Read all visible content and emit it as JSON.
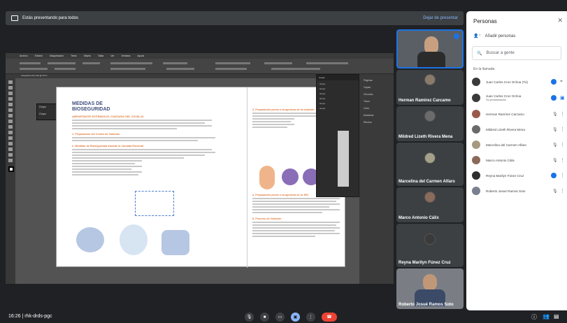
{
  "banner": {
    "presenting_text": "Estás presentando para todos",
    "stop_label": "Dejar de presentar"
  },
  "indesign": {
    "menu_items": [
      "Archivo",
      "Edición",
      "Maquetación",
      "Texto",
      "Objeto",
      "Tabla",
      "Ver",
      "Ventana",
      "Ayuda"
    ],
    "doc_tab": "Infografia-CSV.indd @ 39 %",
    "popup_label": "Grupo",
    "page": {
      "title_line1": "MEDIDAS DE",
      "title_line2": "BIOSEGURIDAD",
      "subtitle": "¡IMPORTANTE! EVITEMOS EL CONTAGIO DEL COVID-19",
      "section1": "1.  Preparación del Centro de Votación",
      "section2": "2.  Medidas de Bioseguridad durante la Jornada Electoral",
      "section3": "3.  Preparación previo a la apertura de la votación",
      "section4": "4.  Preparación previo a la apertura de la JRV",
      "section5": "5.  Proceso de Votación"
    },
    "layers_panel": {
      "title": "Capas",
      "items": [
        "Grupo",
        "Grupo",
        "Grupo",
        "Grupo",
        "Grupo",
        "Grupo"
      ]
    },
    "right_panel": [
      "Páginas",
      "Capas",
      "Vínculos",
      "Trazo",
      "Color",
      "Muestras",
      "Efectos"
    ]
  },
  "tiles": [
    {
      "name": "Herman Ramírez Carcamo"
    },
    {
      "name": "Mildred Lizeth Rivera Mena"
    },
    {
      "name": "Marcelina del Carmen Alfaro"
    },
    {
      "name": "Marco Antonio Cálix"
    },
    {
      "name": "Reyna Marilyn Fúnez Cruz"
    },
    {
      "name": "Roberto Josué Ramos Soto"
    }
  ],
  "people": {
    "title": "Personas",
    "add_label": "Añadir personas",
    "search_placeholder": "Buscar a gente",
    "section_label": "En la llamada",
    "members": [
      {
        "name": "Juan Carlos Cruz Ochoa (Tú)",
        "sub": ""
      },
      {
        "name": "Juan Carlos Cruz Ochoa",
        "sub": "Su presentación"
      },
      {
        "name": "Herman Ramírez Carcamo",
        "sub": ""
      },
      {
        "name": "Mildred Lizeth Rivera Mena",
        "sub": ""
      },
      {
        "name": "Marcelina del Carmen Alfaro",
        "sub": ""
      },
      {
        "name": "Marco Antonio Cálix",
        "sub": ""
      },
      {
        "name": "Reyna Marilyn Fúnez Cruz",
        "sub": ""
      },
      {
        "name": "Roberto Josué Ramos Soto",
        "sub": ""
      }
    ]
  },
  "bottom": {
    "time_code": "16:26  |  rhk-drds-pgc"
  }
}
